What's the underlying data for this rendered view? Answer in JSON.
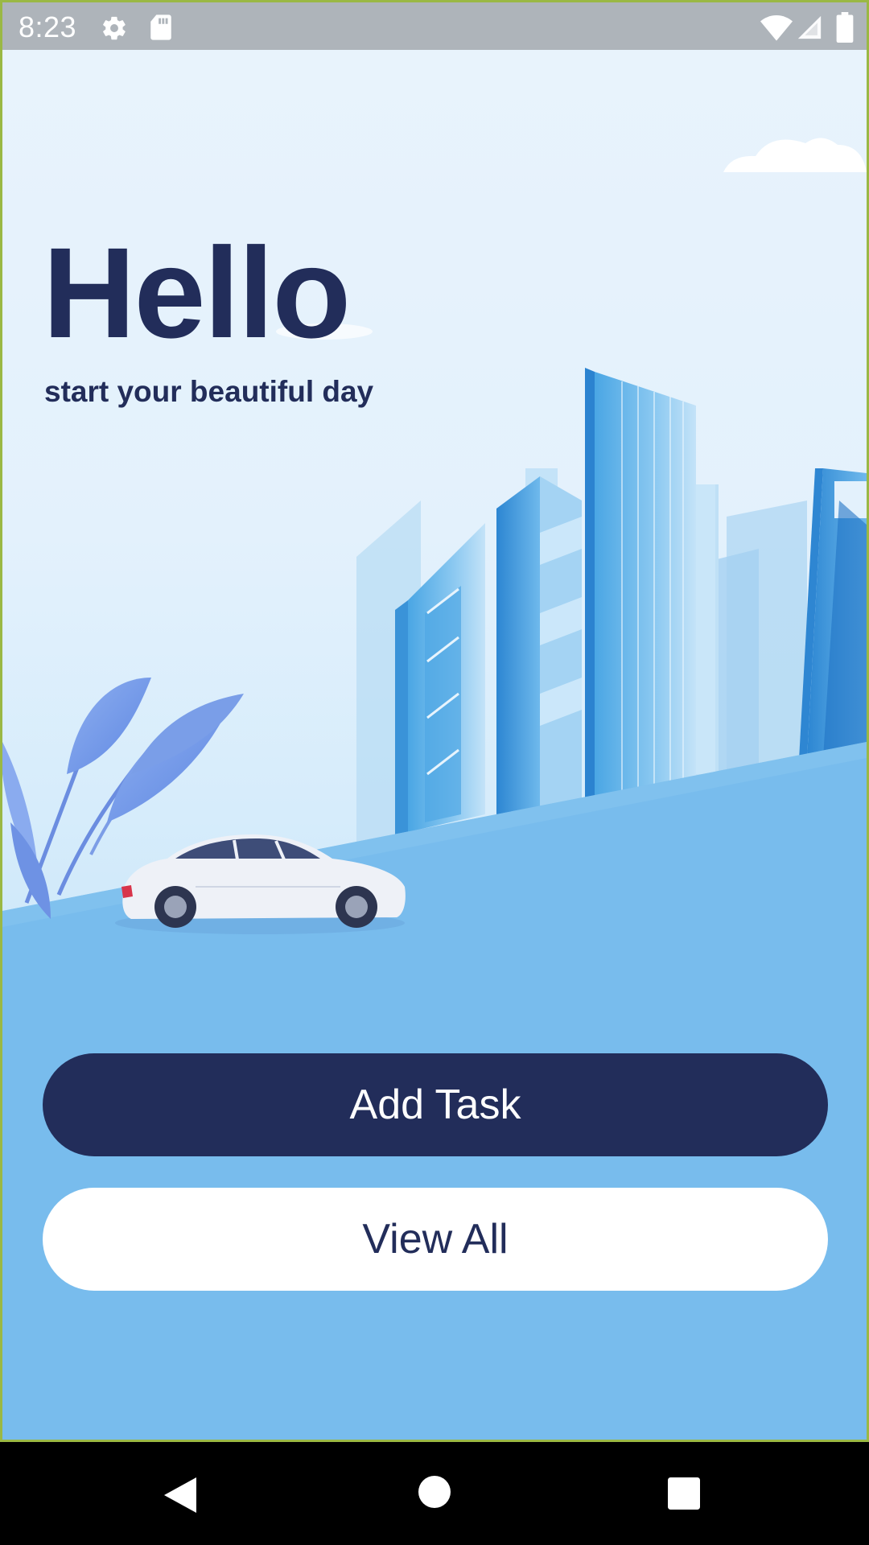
{
  "status_bar": {
    "time": "8:23",
    "left_icons": [
      "gear-icon",
      "sd-card-icon"
    ],
    "right_icons": [
      "wifi-icon",
      "cell-signal-icon",
      "battery-icon"
    ]
  },
  "main": {
    "title": "Hello",
    "subtitle": "start your beautiful day",
    "add_task_label": "Add Task",
    "view_all_label": "View All"
  },
  "nav_bar": {
    "icons": [
      "back-icon",
      "home-icon",
      "recents-icon"
    ]
  },
  "colors": {
    "primary_dark": "#222d5a",
    "ground_blue": "#78bced",
    "sky": "#e6f2fc",
    "status_bar": "#aeb4ba"
  }
}
